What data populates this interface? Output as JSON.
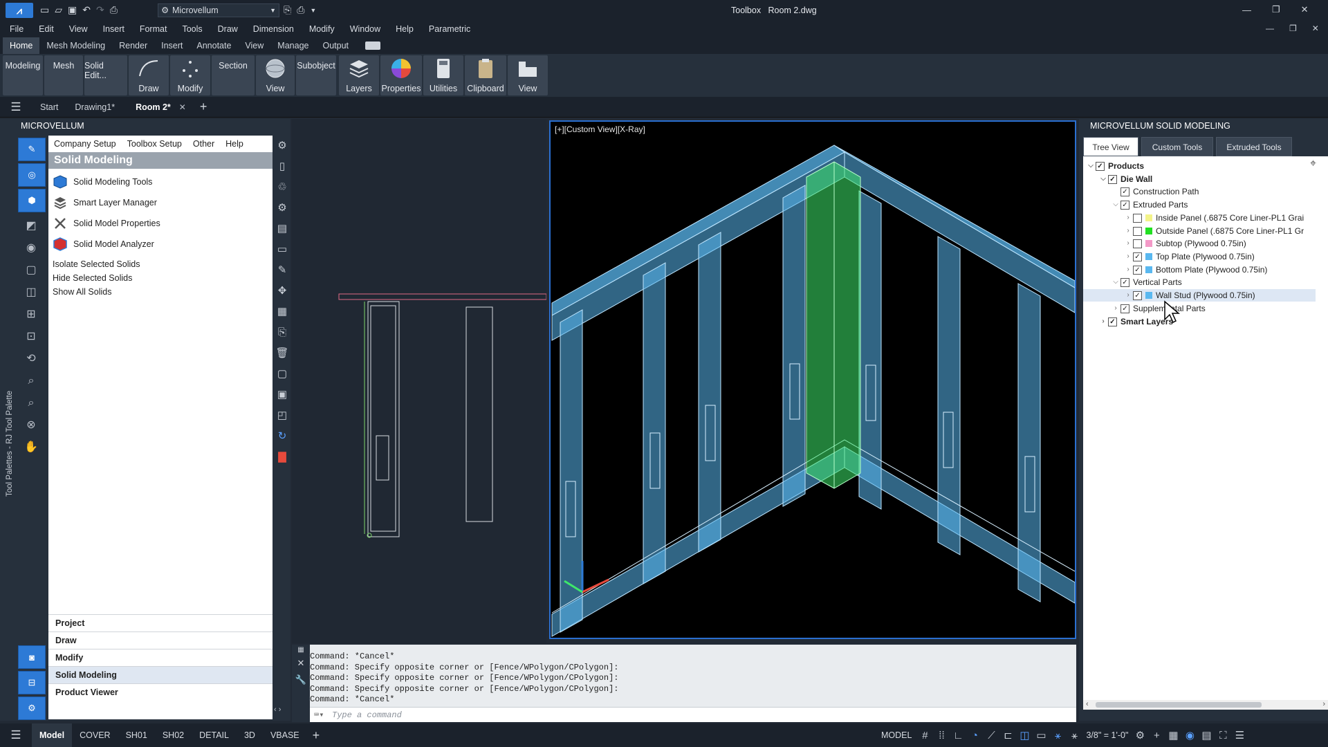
{
  "titlebar": {
    "workspace": "Microvellum",
    "app_label": "Toolbox",
    "file_name": "Room 2.dwg"
  },
  "menubar": [
    "File",
    "Edit",
    "View",
    "Insert",
    "Format",
    "Tools",
    "Draw",
    "Dimension",
    "Modify",
    "Window",
    "Help",
    "Parametric"
  ],
  "ribbon_tabs": [
    "Home",
    "Mesh Modeling",
    "Render",
    "Insert",
    "Annotate",
    "View",
    "Manage",
    "Output"
  ],
  "ribbon_buttons": {
    "modeling": "Modeling",
    "mesh": "Mesh",
    "solid_edit": "Solid Edit...",
    "draw": "Draw",
    "modify": "Modify",
    "section": "Section",
    "view": "View",
    "subobject": "Subobject",
    "layers": "Layers",
    "properties": "Properties",
    "utilities": "Utilities",
    "clipboard": "Clipboard",
    "view2": "View"
  },
  "doc_tabs": {
    "start": "Start",
    "drawing1": "Drawing1*",
    "room2": "Room 2*"
  },
  "left_panel": {
    "title": "MICROVELLUM",
    "side_label": "Tool Palettes - RJ Tool Palette",
    "menu": [
      "Company Setup",
      "Toolbox Setup",
      "Other",
      "Help"
    ],
    "header": "Solid Modeling",
    "tools": [
      "Solid Modeling Tools",
      "Smart Layer Manager",
      "Solid Model Properties",
      "Solid Model Analyzer"
    ],
    "plain_items": [
      "Isolate Selected Solids",
      "Hide Selected Solids",
      "Show All Solids"
    ],
    "palette_tabs": [
      "Project",
      "Draw",
      "Modify",
      "Solid Modeling",
      "Product Viewer"
    ]
  },
  "viewport": {
    "label": "[+][Custom View][X-Ray]"
  },
  "command_lines": [
    "Command: *Cancel*",
    "Command: Specify opposite corner or [Fence/WPolygon/CPolygon]:",
    "Command: Specify opposite corner or [Fence/WPolygon/CPolygon]:",
    "Command: Specify opposite corner or [Fence/WPolygon/CPolygon]:",
    "Command: *Cancel*"
  ],
  "command_placeholder": "Type a command",
  "right_panel": {
    "title": "MICROVELLUM SOLID MODELING",
    "tabs": [
      "Tree View",
      "Custom Tools",
      "Extruded Tools"
    ],
    "tree": [
      {
        "label": "Products",
        "checked": true
      },
      {
        "label": "Die Wall",
        "checked": true
      },
      {
        "label": "Construction Path",
        "checked": true
      },
      {
        "label": "Extruded Parts",
        "checked": true
      },
      {
        "label": "Inside Panel  (.6875 Core Liner-PL1 Grai",
        "checked": false,
        "swatch": "#f4f48a"
      },
      {
        "label": "Outside Panel  (.6875 Core Liner-PL1 Gr",
        "checked": false,
        "swatch": "#22e022"
      },
      {
        "label": "Subtop  (Plywood 0.75in)",
        "checked": false,
        "swatch": "#f49ac8"
      },
      {
        "label": "Top Plate  (Plywood 0.75in)",
        "checked": true,
        "swatch": "#5ab8f0"
      },
      {
        "label": "Bottom Plate  (Plywood 0.75in)",
        "checked": true,
        "swatch": "#5ab8f0"
      },
      {
        "label": "Vertical Parts",
        "checked": true
      },
      {
        "label": "Wall Stud  (Plywood 0.75in)",
        "checked": true,
        "swatch": "#5ab8f0"
      },
      {
        "label": "Supplemental Parts",
        "checked": true
      },
      {
        "label": "Smart Layers",
        "checked": true
      }
    ]
  },
  "status_tabs": [
    "Model",
    "COVER",
    "SH01",
    "SH02",
    "DETAIL",
    "3D",
    "VBASE"
  ],
  "status": {
    "model_label": "MODEL",
    "scale": "3/8\" = 1'-0\""
  },
  "colors": {
    "accent": "#2d7ad6",
    "viewport_border": "#2a6fd1",
    "frame": "#5ab8f0",
    "highlight": "#3ee86a"
  }
}
